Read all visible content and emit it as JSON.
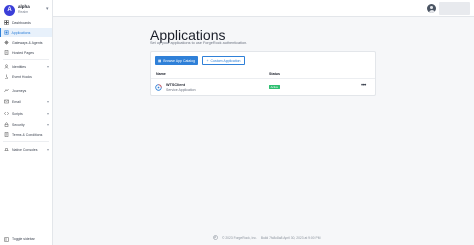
{
  "realm": {
    "initial": "A",
    "name": "alpha",
    "subtitle": "Realm"
  },
  "sidebar": {
    "items": [
      {
        "label": "Dashboards",
        "icon": "dashboard-icon"
      },
      {
        "label": "Applications",
        "icon": "apps-icon",
        "active": true
      },
      {
        "label": "Gateways & Agents",
        "icon": "gateway-icon"
      },
      {
        "label": "Hosted Pages",
        "icon": "pages-icon"
      },
      {
        "label": "Identities",
        "icon": "identities-icon"
      },
      {
        "label": "Event Hooks",
        "icon": "hooks-icon"
      },
      {
        "label": "Journeys",
        "icon": "journeys-icon"
      },
      {
        "label": "Email",
        "icon": "email-icon"
      },
      {
        "label": "Scripts",
        "icon": "scripts-icon"
      },
      {
        "label": "Security",
        "icon": "security-icon"
      },
      {
        "label": "Terms & Conditions",
        "icon": "terms-icon"
      },
      {
        "label": "Native Consoles",
        "icon": "native-consoles-icon"
      }
    ],
    "toggle_label": "Toggle sidebar"
  },
  "page": {
    "title": "Applications",
    "subtitle": "Set up your applications to use ForgeRock authentication."
  },
  "actions": {
    "browse_label": "Browse App Catalog",
    "custom_label": "Custom Application"
  },
  "table": {
    "columns": [
      "Name",
      "Status"
    ],
    "rows": [
      {
        "name": "WTSClient",
        "type": "Service Application",
        "status": "Active"
      }
    ]
  },
  "footer": {
    "copyright": "© 2023 ForgeRock, Inc.",
    "build": "Build 7fc8c8a8 April 30, 2023 at 9:00 PM"
  },
  "colors": {
    "accent": "#2f80d8",
    "realm_avatar": "#3b3fd8",
    "status_active": "#2fbf71"
  }
}
